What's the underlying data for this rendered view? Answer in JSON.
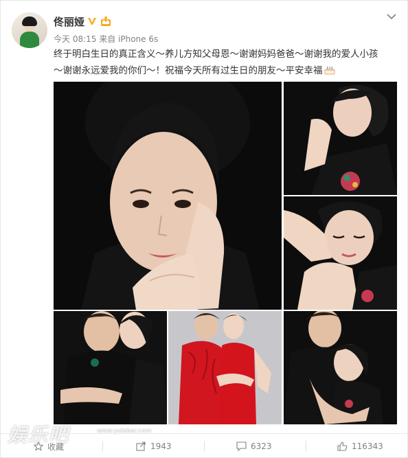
{
  "post": {
    "author": "佟丽娅",
    "meta": "今天 08:15 来自 iPhone 6s",
    "text_lines": [
      "终于明白生日的真正含义～养儿方知父母恩～谢谢妈妈爸爸～谢谢我的爱人小孩",
      "～谢谢永远爱我的你们～！祝福今天所有过生日的朋友～平安幸福"
    ]
  },
  "actions": {
    "favorite_label": "收藏",
    "forward_count": "1943",
    "comment_count": "6323",
    "like_count": "116343"
  },
  "watermark": {
    "logo_text": "娱乐吧",
    "url_text": "www.yulebar.com"
  },
  "colors": {
    "accent": "#f7ac1f",
    "text": "#333333",
    "muted": "#808080",
    "dress_red": "#d4141d"
  },
  "icons": [
    "verified-v-icon",
    "vip-crown-icon",
    "chevron-down-icon",
    "cake-emoji-icon",
    "star-icon",
    "forward-icon",
    "comment-icon",
    "thumbs-up-icon"
  ]
}
